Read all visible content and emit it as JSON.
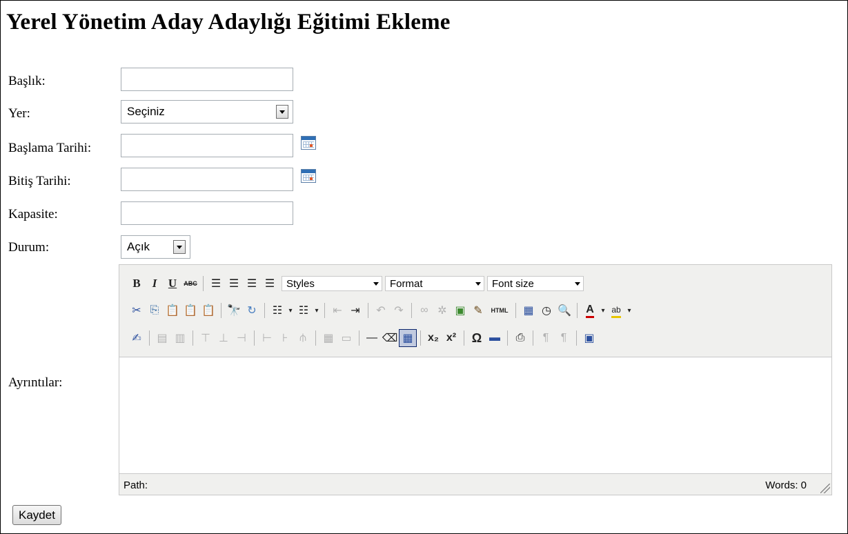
{
  "page": {
    "title": "Yerel Yönetim Aday Adaylığı Eğitimi Ekleme"
  },
  "form": {
    "baslik_label": "Başlık:",
    "yer_label": "Yer:",
    "yer_value": "Seçiniz",
    "baslama_label": "Başlama Tarihi:",
    "bitis_label": "Bitiş Tarihi:",
    "kapasite_label": "Kapasite:",
    "durum_label": "Durum:",
    "durum_value": "Açık",
    "ayrintilar_label": "Ayrıntılar:",
    "save_label": "Kaydet"
  },
  "editor": {
    "styles": "Styles",
    "format": "Format",
    "font_size": "Font size",
    "path_label": "Path:",
    "words_label": "Words: 0"
  },
  "icons": {
    "bold": "B",
    "italic": "I",
    "underline": "U",
    "strikethrough": "ABC",
    "html": "HTML",
    "subscript": "x₂",
    "superscript": "x²",
    "omega": "Ω"
  }
}
